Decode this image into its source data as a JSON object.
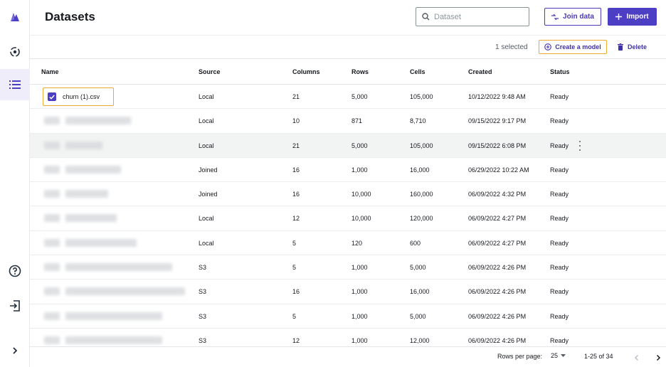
{
  "header": {
    "title": "Datasets",
    "search_placeholder": "Dataset",
    "join_label": "Join data",
    "import_label": "Import"
  },
  "actions": {
    "selected_text": "1 selected",
    "create_model_label": "Create a model",
    "delete_label": "Delete"
  },
  "table": {
    "columns": [
      "Name",
      "Source",
      "Columns",
      "Rows",
      "Cells",
      "Created",
      "Status"
    ],
    "rows": [
      {
        "name": "churn (1).csv",
        "source": "Local",
        "columns": "21",
        "rows": "5,000",
        "cells": "105,000",
        "created": "10/12/2022 9:48 AM",
        "status": "Ready",
        "selected": true
      },
      {
        "name": "",
        "source": "Local",
        "columns": "10",
        "rows": "871",
        "cells": "8,710",
        "created": "09/15/2022 9:17 PM",
        "status": "Ready"
      },
      {
        "name": "",
        "source": "Local",
        "columns": "21",
        "rows": "5,000",
        "cells": "105,000",
        "created": "09/15/2022 6:08 PM",
        "status": "Ready",
        "hover": true
      },
      {
        "name": "",
        "source": "Joined",
        "columns": "16",
        "rows": "1,000",
        "cells": "16,000",
        "created": "06/29/2022 10:22 AM",
        "status": "Ready"
      },
      {
        "name": "",
        "source": "Joined",
        "columns": "16",
        "rows": "10,000",
        "cells": "160,000",
        "created": "06/09/2022 4:32 PM",
        "status": "Ready"
      },
      {
        "name": "",
        "source": "Local",
        "columns": "12",
        "rows": "10,000",
        "cells": "120,000",
        "created": "06/09/2022 4:27 PM",
        "status": "Ready"
      },
      {
        "name": "",
        "source": "Local",
        "columns": "5",
        "rows": "120",
        "cells": "600",
        "created": "06/09/2022 4:27 PM",
        "status": "Ready"
      },
      {
        "name": "",
        "source": "S3",
        "columns": "5",
        "rows": "1,000",
        "cells": "5,000",
        "created": "06/09/2022 4:26 PM",
        "status": "Ready"
      },
      {
        "name": "",
        "source": "S3",
        "columns": "16",
        "rows": "1,000",
        "cells": "16,000",
        "created": "06/09/2022 4:26 PM",
        "status": "Ready"
      },
      {
        "name": "",
        "source": "S3",
        "columns": "5",
        "rows": "1,000",
        "cells": "5,000",
        "created": "06/09/2022 4:26 PM",
        "status": "Ready"
      },
      {
        "name": "",
        "source": "S3",
        "columns": "12",
        "rows": "1,000",
        "cells": "12,000",
        "created": "06/09/2022 4:26 PM",
        "status": "Ready"
      }
    ]
  },
  "footer": {
    "rows_per_page_label": "Rows per page:",
    "rows_per_page_value": "25",
    "range_text": "1-25 of 34"
  },
  "colors": {
    "accent": "#4d3fc4",
    "focus": "#f0a835"
  },
  "icons": {
    "rail": [
      "canvas-logo-icon",
      "models-icon",
      "datasets-icon",
      "help-icon",
      "sign-out-icon",
      "expand-icon"
    ]
  }
}
